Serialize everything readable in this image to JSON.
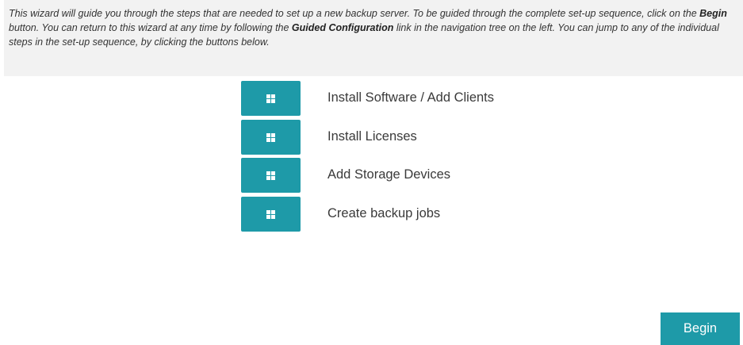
{
  "intro": {
    "seg1": "This wizard will guide you through the steps that are needed to set up a new backup server. To be guided through the complete set-up sequence, click on the ",
    "begin_word": "Begin",
    "seg2": " button. You can return to this wizard at any time by following the ",
    "guided_word": "Guided Configuration",
    "seg3": " link in the navigation tree on the left. You can jump to any of the individual steps in the set-up sequence, by clicking the buttons below."
  },
  "steps": [
    {
      "label": "Install Software / Add Clients",
      "icon": "grid-icon"
    },
    {
      "label": "Install Licenses",
      "icon": "grid-icon"
    },
    {
      "label": "Add Storage Devices",
      "icon": "grid-icon"
    },
    {
      "label": "Create backup jobs",
      "icon": "grid-icon"
    }
  ],
  "begin_button": {
    "label": "Begin"
  },
  "colors": {
    "accent": "#1e9aa8",
    "panel_background": "#f2f2f2",
    "text": "#3a3a3a"
  }
}
